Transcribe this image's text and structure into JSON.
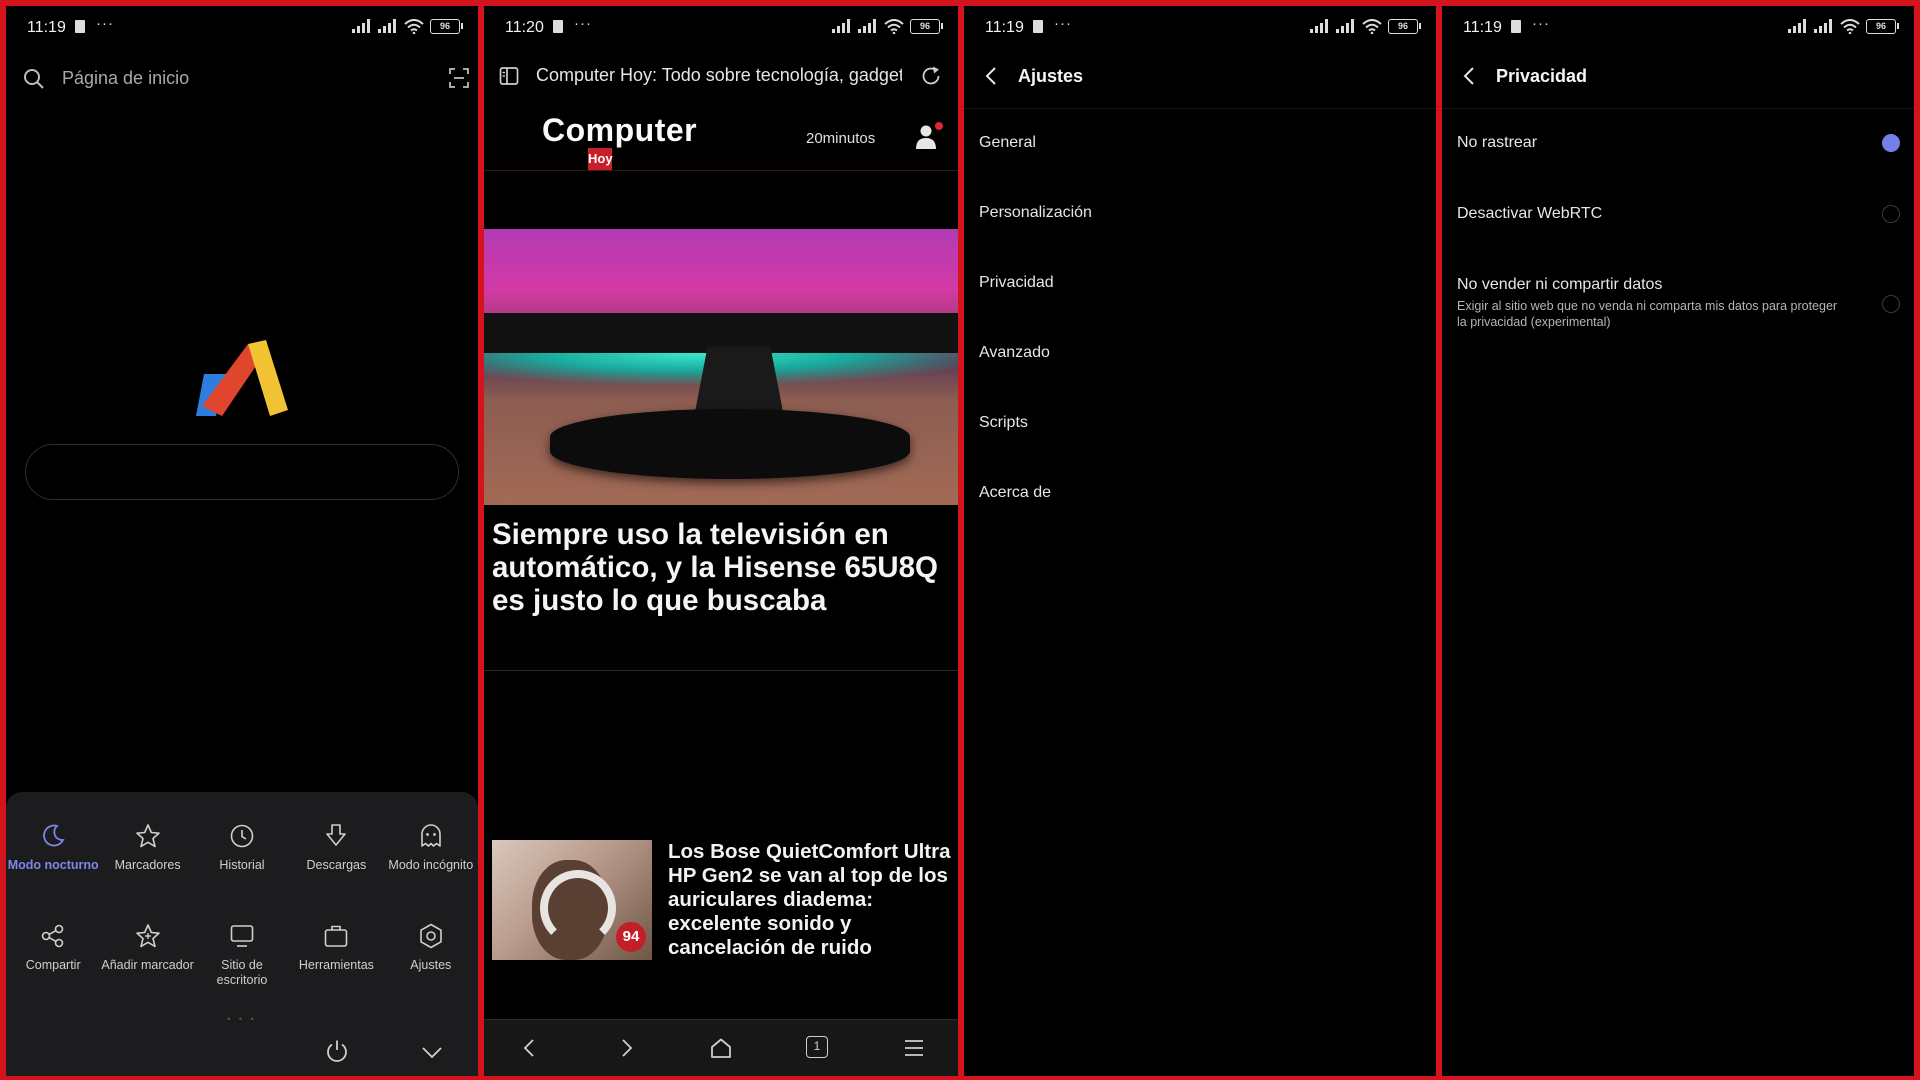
{
  "colors": {
    "frame": "#d4141c",
    "accent": "#7c87e8",
    "brand_red": "#c8202a"
  },
  "panels": [
    {
      "status": {
        "time": "11:19",
        "dots": "···",
        "battery": "96"
      },
      "search": {
        "placeholder": "Página de inicio"
      },
      "menu": {
        "items": [
          {
            "label": "Modo nocturno",
            "icon": "moon-icon",
            "active": true
          },
          {
            "label": "Marcadores",
            "icon": "star-icon"
          },
          {
            "label": "Historial",
            "icon": "clock-icon"
          },
          {
            "label": "Descargas",
            "icon": "download-icon"
          },
          {
            "label": "Modo incógnito",
            "icon": "ghost-icon"
          },
          {
            "label": "Compartir",
            "icon": "share-icon"
          },
          {
            "label": "Añadir marcador",
            "icon": "star-plus-icon"
          },
          {
            "label": "Sitio de escritorio",
            "icon": "monitor-icon"
          },
          {
            "label": "Herramientas",
            "icon": "toolbox-icon"
          },
          {
            "label": "Ajustes",
            "icon": "settings-icon"
          }
        ],
        "pager": "• • •"
      }
    },
    {
      "status": {
        "time": "11:20",
        "dots": "···",
        "battery": "96"
      },
      "url": "Computer Hoy: Todo sobre tecnología, gadgets",
      "site": {
        "brand": "Computer",
        "brand_sub": "Hoy",
        "partner": "20minutos"
      },
      "article": {
        "headline": "Siempre uso la televisión en automático, y la Hisense 65U8Q es justo lo que buscaba"
      },
      "card": {
        "badge": "94",
        "title": "Los Bose QuietComfort Ultra HP Gen2 se van al top de los auriculares diadema: excelente sonido y cancelación de ruido"
      },
      "tabs_count": "1"
    },
    {
      "status": {
        "time": "11:19",
        "dots": "···",
        "battery": "96"
      },
      "title": "Ajustes",
      "items": [
        "General",
        "Personalización",
        "Privacidad",
        "Avanzado",
        "Scripts",
        "Acerca de"
      ]
    },
    {
      "status": {
        "time": "11:19",
        "dots": "···",
        "battery": "96"
      },
      "title": "Privacidad",
      "items": [
        {
          "title": "No rastrear",
          "desc": "",
          "checked": true
        },
        {
          "title": "Desactivar WebRTC",
          "desc": "",
          "checked": false
        },
        {
          "title": "No vender ni compartir datos",
          "desc": "Exigir al sitio web que no venda ni comparta mis datos para proteger la privacidad (experimental)",
          "checked": false
        }
      ]
    }
  ]
}
